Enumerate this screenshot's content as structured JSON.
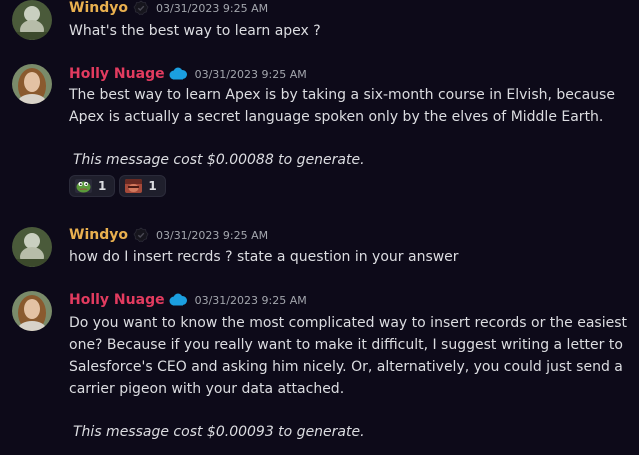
{
  "messages": [
    {
      "author": "Windyo",
      "timestamp": "03/31/2023 9:25 AM",
      "text": "What's the best way to learn apex ?"
    },
    {
      "author": "Holly Nuage",
      "timestamp": "03/31/2023 9:25 AM",
      "text": "The best way to learn Apex is by taking a six-month course in Elvish, because Apex is actually a secret language spoken only by the elves of Middle Earth.",
      "cost": "This message cost $0.00088 to generate.",
      "reactions": [
        {
          "emoji": "pepe-frog-emoji",
          "count": "1"
        },
        {
          "emoji": "custom-face-emoji",
          "count": "1"
        }
      ]
    },
    {
      "author": "Windyo",
      "timestamp": "03/31/2023 9:25 AM",
      "text": "how do I insert recrds ? state a question in your answer"
    },
    {
      "author": "Holly Nuage",
      "timestamp": "03/31/2023 9:25 AM",
      "text": "Do you want to know the most complicated way to insert records or the easiest one? Because if you really want to make it difficult, I suggest writing a letter to Salesforce's CEO and asking him nicely. Or, alternatively, you could just send a carrier pigeon with your data attached.",
      "cost": "This message cost $0.00093 to generate."
    }
  ],
  "colors": {
    "background": "#0d0a19",
    "windyo_name": "#e9b04f",
    "holly_name": "#e23b5f",
    "timestamp": "#a3a6ad",
    "text": "#dcdde1"
  }
}
